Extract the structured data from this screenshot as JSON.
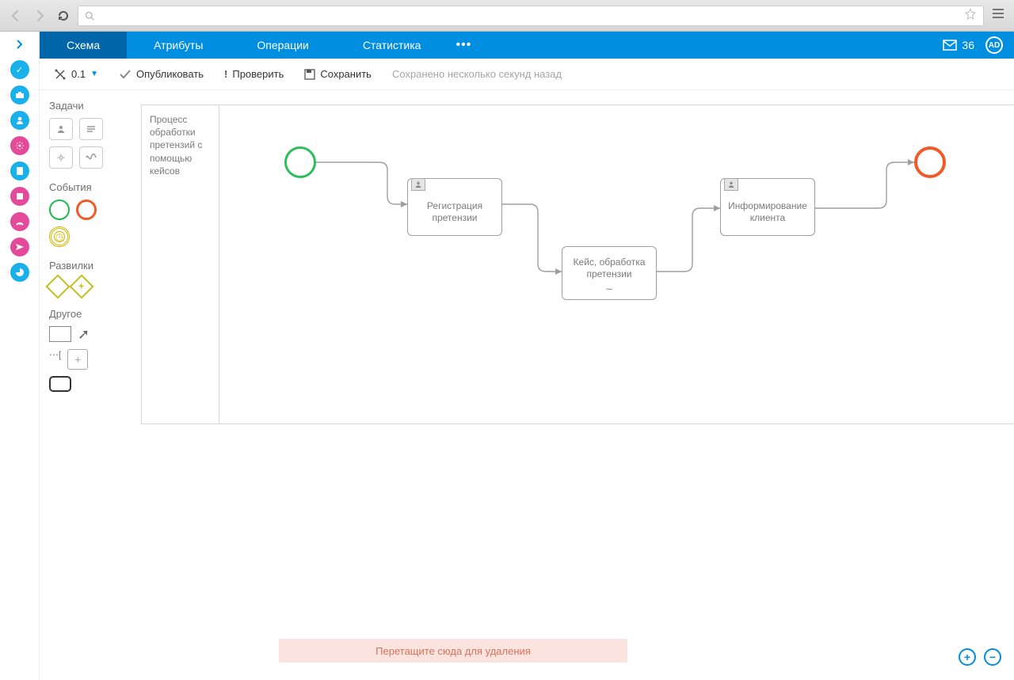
{
  "topbar": {
    "tabs": [
      "Схема",
      "Атрибуты",
      "Операции",
      "Статистика"
    ],
    "active_tab": 0,
    "mail_count": "36",
    "avatar_initials": "AD"
  },
  "toolbar": {
    "version": "0.1",
    "publish": "Опубликовать",
    "check": "Проверить",
    "save": "Сохранить",
    "saved_status": "Сохранено несколько секунд назад"
  },
  "palette": {
    "tasks_title": "Задачи",
    "events_title": "События",
    "gateways_title": "Развилки",
    "other_title": "Другое"
  },
  "canvas": {
    "pool_label": "Процесс обработки претензий с помощью кейсов",
    "task1": "Регистрация претензии",
    "task2": "Кейс, обработка претензии",
    "task3": "Информирование клиента"
  },
  "delete_zone": "Перетащите сюда для удаления",
  "rail_colors": {
    "c1": "#1ab0ec",
    "c2": "#1ab0ec",
    "c3": "#1ab0ec",
    "c4": "#e34b9a",
    "c5": "#1ab0ec",
    "c6": "#e34b9a",
    "c7": "#e34b9a",
    "c8": "#e34b9a",
    "c9": "#1ab0ec"
  }
}
